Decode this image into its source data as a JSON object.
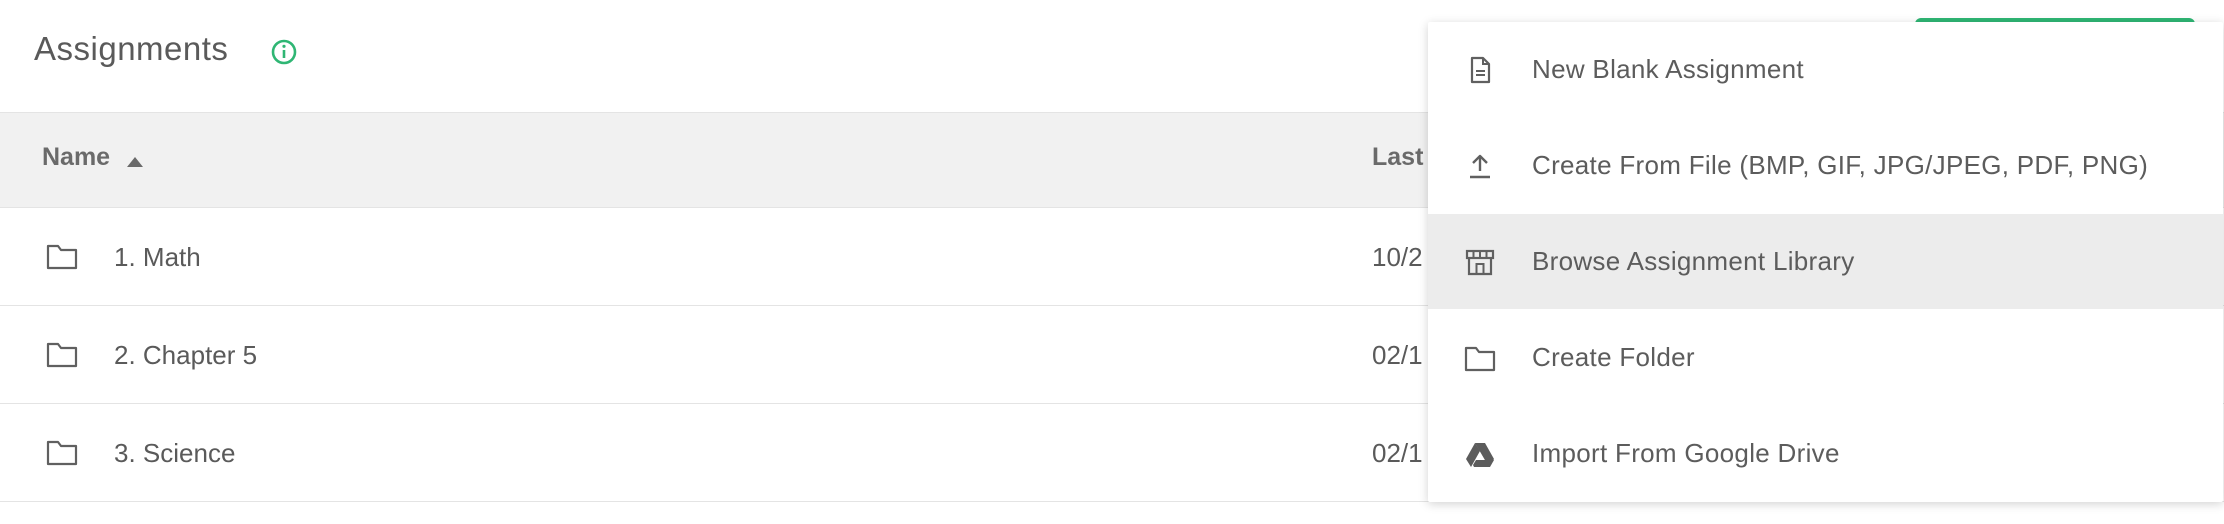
{
  "header": {
    "title": "Assignments",
    "info_icon": "info-icon",
    "accent_color": "#2fb674"
  },
  "table": {
    "columns": {
      "name": "Name",
      "last": "Last"
    },
    "rows": [
      {
        "name": "1. Math",
        "date_partial": "10/2"
      },
      {
        "name": "2. Chapter 5",
        "date_partial": "02/1"
      },
      {
        "name": "3. Science",
        "date_partial": "02/1"
      }
    ]
  },
  "menu": {
    "items": [
      {
        "label": "New Blank Assignment",
        "icon": "document-icon"
      },
      {
        "label": "Create From File (BMP, GIF, JPG/JPEG, PDF, PNG)",
        "icon": "upload-icon"
      },
      {
        "label": "Browse Assignment Library",
        "icon": "store-icon",
        "highlighted": true
      },
      {
        "label": "Create Folder",
        "icon": "folder-icon"
      },
      {
        "label": "Import From Google Drive",
        "icon": "google-drive-icon"
      }
    ]
  }
}
